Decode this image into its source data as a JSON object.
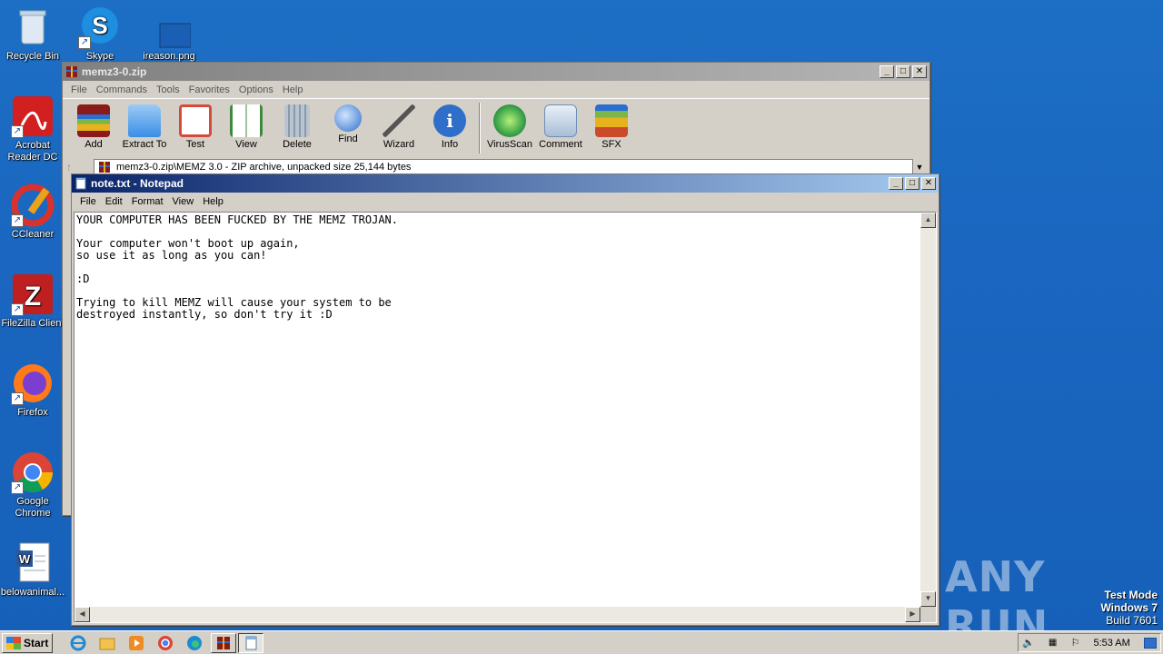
{
  "desktop": {
    "icons": [
      {
        "label": "Recycle Bin",
        "icon": "recycle-bin-icon"
      },
      {
        "label": "Skype",
        "icon": "skype-icon"
      },
      {
        "label": "ireason.png",
        "icon": "image-file-icon"
      },
      {
        "label": "Acrobat Reader DC",
        "icon": "acrobat-icon"
      },
      {
        "label": "CCleaner",
        "icon": "ccleaner-icon"
      },
      {
        "label": "FileZilla Client",
        "icon": "filezilla-icon"
      },
      {
        "label": "Firefox",
        "icon": "firefox-icon"
      },
      {
        "label": "Google Chrome",
        "icon": "chrome-icon"
      },
      {
        "label": "belowanimal...",
        "icon": "word-document-icon"
      }
    ],
    "watermark": "ANY RUN",
    "test_mode": {
      "line1": "Test Mode",
      "line2": "Windows 7",
      "line3": "Build 7601"
    }
  },
  "winrar": {
    "title": "memz3-0.zip",
    "menu": [
      "File",
      "Commands",
      "Tools",
      "Favorites",
      "Options",
      "Help"
    ],
    "toolbar": [
      {
        "label": "Add",
        "icon": "winrar-add-icon",
        "color": "#c0392b"
      },
      {
        "label": "Extract To",
        "icon": "folder-icon",
        "color": "#3a8ee6"
      },
      {
        "label": "Test",
        "icon": "clipboard-check-icon",
        "color": "#d64a3b"
      },
      {
        "label": "View",
        "icon": "book-icon",
        "color": "#3d8a3d"
      },
      {
        "label": "Delete",
        "icon": "trash-icon",
        "color": "#8a9aa8"
      },
      {
        "label": "Find",
        "icon": "magnifier-icon",
        "color": "#2f6fc9"
      },
      {
        "label": "Wizard",
        "icon": "wand-icon",
        "color": "#7ab648"
      },
      {
        "label": "Info",
        "icon": "info-icon",
        "color": "#2f6fc9"
      },
      {
        "label": "VirusScan",
        "icon": "virus-scan-icon",
        "color": "#3aa34a"
      },
      {
        "label": "Comment",
        "icon": "comment-icon",
        "color": "#6e8fb8"
      },
      {
        "label": "SFX",
        "icon": "sfx-icon",
        "color": "#c94b2a"
      }
    ],
    "path": "memz3-0.zip\\MEMZ 3.0 - ZIP archive, unpacked size 25,144 bytes"
  },
  "notepad": {
    "title": "note.txt - Notepad",
    "menu": [
      "File",
      "Edit",
      "Format",
      "View",
      "Help"
    ],
    "content": "YOUR COMPUTER HAS BEEN FUCKED BY THE MEMZ TROJAN.\n\nYour computer won't boot up again,\nso use it as long as you can!\n\n:D\n\nTrying to kill MEMZ will cause your system to be\ndestroyed instantly, so don't try it :D"
  },
  "taskbar": {
    "start_label": "Start",
    "clock": "5:53 AM"
  }
}
